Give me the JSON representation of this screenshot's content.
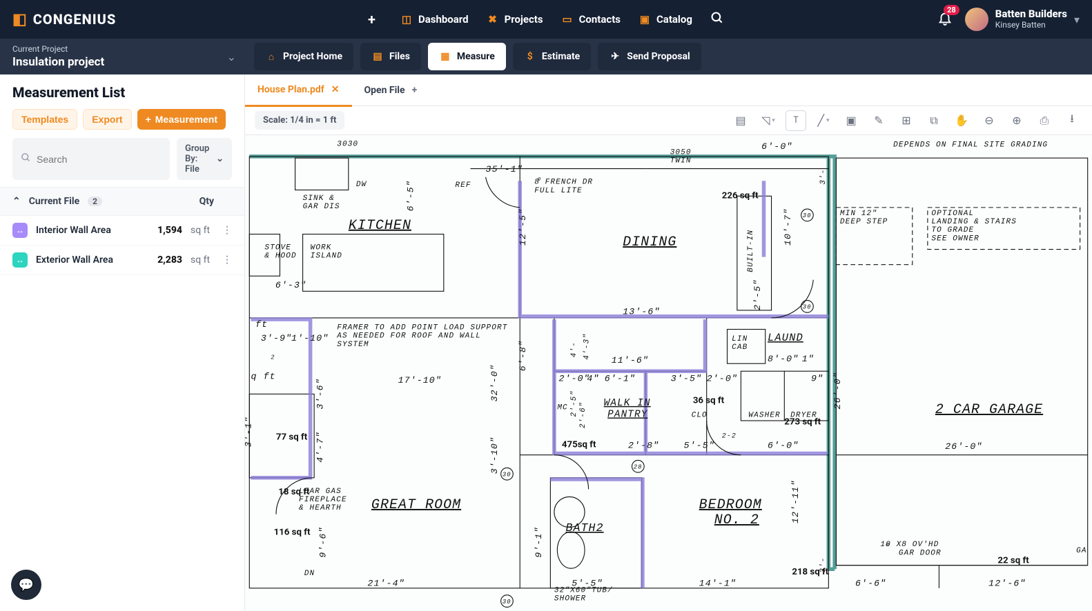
{
  "brand": {
    "con": "CON",
    "genius": "GENIUS"
  },
  "topnav": {
    "dashboard": "Dashboard",
    "projects": "Projects",
    "contacts": "Contacts",
    "catalog": "Catalog"
  },
  "notifications": "28",
  "user": {
    "company": "Batten Builders",
    "name": "Kinsey Batten"
  },
  "project": {
    "label": "Current Project",
    "name": "Insulation project"
  },
  "sectabs": {
    "home": "Project Home",
    "files": "Files",
    "measure": "Measure",
    "estimate": "Estimate",
    "proposal": "Send Proposal"
  },
  "sidebar": {
    "title": "Measurement List",
    "templates": "Templates",
    "export": "Export",
    "measurement": "Measurement",
    "search_ph": "Search",
    "group": "Group By: File",
    "colfile": "Current File",
    "count": "2",
    "colqty": "Qty",
    "rows": [
      {
        "name": "Interior Wall Area",
        "value": "1,594",
        "unit": "sq ft"
      },
      {
        "name": "Exterior Wall Area",
        "value": "2,283",
        "unit": "sq ft"
      }
    ]
  },
  "filetabs": {
    "active": "House Plan.pdf",
    "open": "Open File"
  },
  "toolbar": {
    "scale": "Scale: 1/4 in = 1 ft"
  },
  "blueprint": {
    "rooms": {
      "kitchen": "KITCHEN",
      "dining": "DINING",
      "laund": "LAUND",
      "walkin": "WALK IN",
      "pantry": "PANTRY",
      "greatroom": "GREAT ROOM",
      "bath2": "BATH2",
      "bedroom": "BEDROOM",
      "no2": "NO. 2",
      "garage": "2 CAR GARAGE"
    },
    "labels": {
      "sink": "SINK &",
      "gardis": "GAR DIS",
      "stove": "STOVE",
      "hood": "& HOOD",
      "work": "WORK",
      "island": "ISLAND",
      "dw": "DW",
      "ref": "REF",
      "french1": "8   FRENCH DR",
      "french2": "FULL LITE",
      "builtin": "BUILT-IN",
      "lin": "LIN",
      "cab": "CAB",
      "clo": "CLO",
      "washer": "WASHER",
      "dryer": "DRYER",
      "mc": "MC",
      "framer1": "FRAMER TO ADD POINT LOAD SUPPORT",
      "framer2": "AS NEEDED FOR ROOF AND WALL",
      "framer3": "SYSTEM",
      "gas1": "LEAR GAS",
      "gas2": "FIREPLACE",
      "gas3": "& HEARTH",
      "dn": "DN",
      "tub1": "32\"X60\"TUB/",
      "tub2": "SHOWER",
      "gd1": "10 X8  OV'HD",
      "gd2": "GAR DOOR",
      "depends": "DEPENDS ON FINAL SITE GRADING",
      "min1": "MIN 12\"",
      "min2": "DEEP STEP",
      "opt1": "OPTIONAL",
      "opt2": "LANDING & STAIRS",
      "opt3": "TO GRADE",
      "opt4": "SEE OWNER",
      "ga": "GA",
      "twin1": "3050",
      "twin2": "TWIN",
      "d3030": "3030",
      "o0": "0",
      "o2": "2"
    },
    "dims": {
      "d35_1": "35'-1\"",
      "d6_0a": "6'-0\"",
      "d6_5": "6'-5\"",
      "d12_5": "12'-5\"",
      "d10_7": "10'-7\"",
      "d6_3": "6'-3\"",
      "ft": "ft",
      "q_ft": "q ft",
      "d3_9": "3'-9\"",
      "d1_10": "1'-10\"",
      "d17_10": "17'-10\"",
      "d32_0": "32'-0\"",
      "d6_8": "6'-8\"",
      "d3_6": "3'-6\"",
      "d3_1": "3'-1\"",
      "d4_7": "4'-7\"",
      "d9_6": "9'-6\"",
      "d21_4": "21'-4\"",
      "d3_10": "3'-10\"",
      "d9_1": "9'-1\"",
      "d5_5": "5'-5\"",
      "d14_1": "14'-1\"",
      "d13_6": "13'-6\"",
      "d2_5": "2'-5\"",
      "d8_0": "8'-0\"",
      "d1": "1\"",
      "d2_0a": "2'-0\"",
      "d4": "4\"",
      "d6_1": "6'-1\"",
      "d3_5": "3'-5\"",
      "d2_0b": "2'-0\"",
      "d9": "9\"",
      "d2_5b": "2'-5\"",
      "d11_6": "11'-6\"",
      "d4_3": "4'-3\"",
      "d2_8": "2'-8\"",
      "d5_5b": "5'-5\"",
      "d2_20": "2-2",
      "d6_0b": "6'-0\"",
      "d26_0a": "26'-0\"",
      "d26_0b": "26'-0\"",
      "d12_11": "12'-11\"",
      "d6_6": "6'-6\"",
      "d12_6": "12'-6\"",
      "d3a": "3'-",
      "d3b": "3'-",
      "d2_6": "2'-6\"",
      "d4b": "4'-",
      "o30a": "30",
      "o30b": "30",
      "o30c": "30",
      "o30d": "30",
      "o28": "28"
    },
    "areas": {
      "a226": "226 sq ft",
      "a36": "36 sq ft",
      "a273": "273 sq ft",
      "a475": "475sq ft",
      "a77": "77 sq ft",
      "a18": "18 sq ft",
      "a116": "116 sq ft",
      "a218": "218 sq ft",
      "a22": "22 sq ft"
    }
  }
}
